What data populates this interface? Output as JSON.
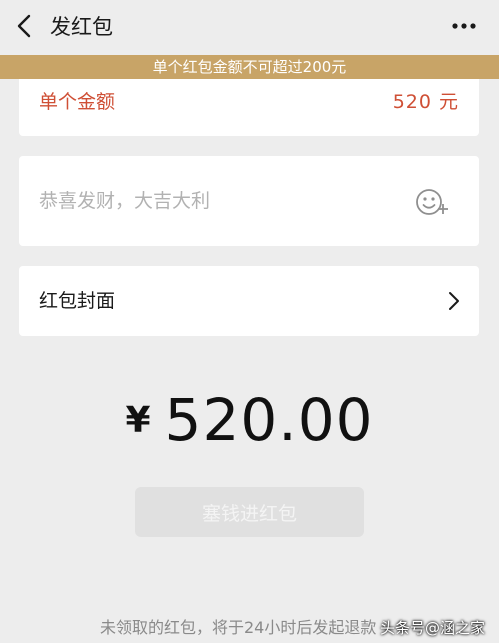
{
  "nav": {
    "title": "发红包",
    "back_icon": "chevron-left-icon",
    "more_icon": "more-dots-icon"
  },
  "notice": {
    "text": "单个红包金额不可超过200元",
    "background": "#c8a467"
  },
  "amount": {
    "label": "单个金额",
    "value": "520 元",
    "color": "#cf4f35"
  },
  "greeting": {
    "placeholder": "恭喜发财，大吉大利",
    "value": "",
    "emoji_icon": "emoji-add-icon"
  },
  "cover": {
    "label": "红包封面",
    "chevron_icon": "chevron-right-icon"
  },
  "total": {
    "symbol": "¥",
    "value": "520.00"
  },
  "submit": {
    "label": "塞钱进红包"
  },
  "footer": {
    "note": "未领取的红包，将于24小时后发起退款"
  },
  "watermark": {
    "text": "头条号@涵之家"
  }
}
